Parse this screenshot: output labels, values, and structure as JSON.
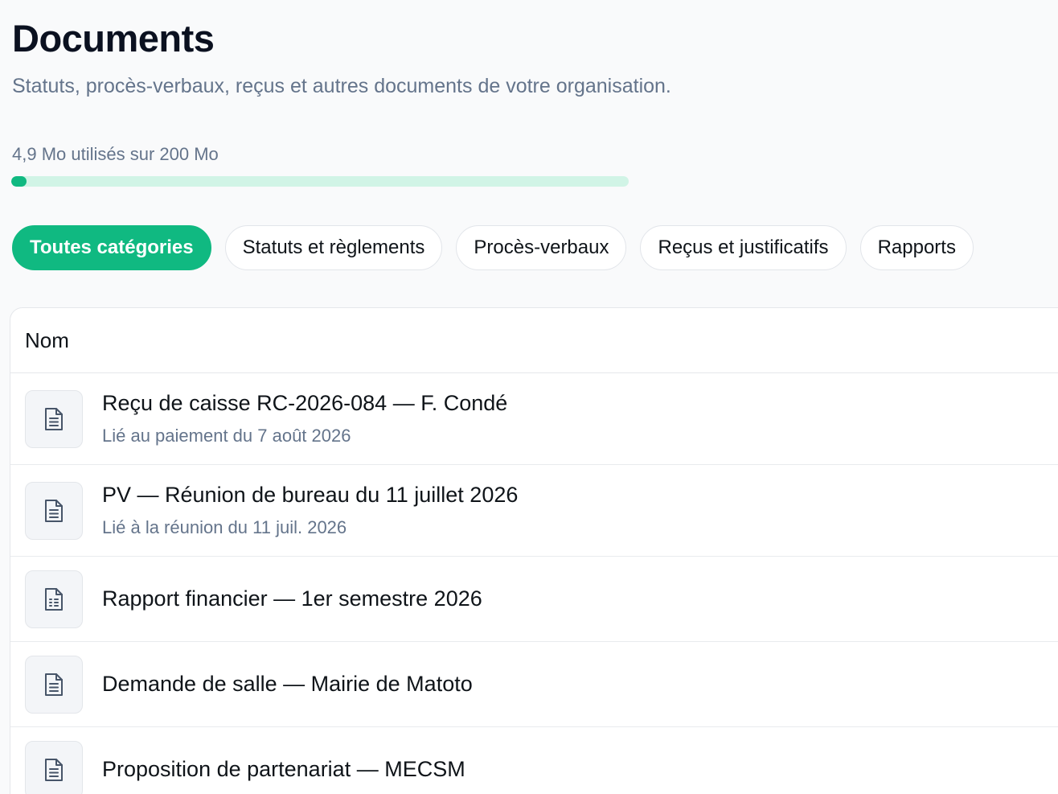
{
  "page": {
    "title": "Documents",
    "subtitle": "Statuts, procès-verbaux, reçus et autres documents de votre organisation."
  },
  "storage": {
    "label": "4,9 Mo utilisés sur 200 Mo",
    "used_mb": 4.9,
    "total_mb": 200
  },
  "filters": [
    {
      "label": "Toutes catégories",
      "active": true
    },
    {
      "label": "Statuts et règlements",
      "active": false
    },
    {
      "label": "Procès-verbaux",
      "active": false
    },
    {
      "label": "Reçus et justificatifs",
      "active": false
    },
    {
      "label": "Rapports",
      "active": false
    }
  ],
  "table": {
    "column_name": "Nom",
    "rows": [
      {
        "title": "Reçu de caisse RC-2026-084 — F. Condé",
        "subtitle": "Lié au paiement du 7 août 2026",
        "icon": "document-text-icon"
      },
      {
        "title": "PV — Réunion de bureau du 11 juillet 2026",
        "subtitle": "Lié à la réunion du 11 juil. 2026",
        "icon": "document-text-icon"
      },
      {
        "title": "Rapport financier — 1er semestre 2026",
        "subtitle": "",
        "icon": "document-spreadsheet-icon"
      },
      {
        "title": "Demande de salle — Mairie de Matoto",
        "subtitle": "",
        "icon": "document-text-icon"
      },
      {
        "title": "Proposition de partenariat — MECSM",
        "subtitle": "",
        "icon": "document-text-icon"
      }
    ]
  },
  "colors": {
    "accent": "#10b981",
    "accent_light": "#d1f4e6",
    "muted_text": "#64748b"
  }
}
